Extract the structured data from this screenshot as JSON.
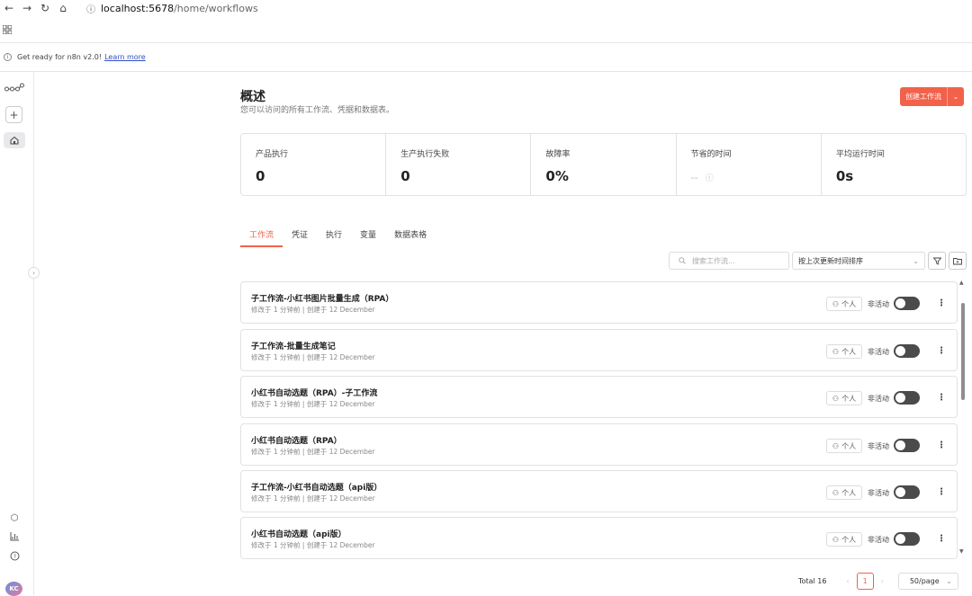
{
  "browser": {
    "url_host": "localhost:5678",
    "url_path": "/home/workflows"
  },
  "banner": {
    "text": "Get ready for n8n v2.0!",
    "link": "Learn more"
  },
  "sidebar": {
    "avatar_initials": "KC"
  },
  "header": {
    "title": "概述",
    "subtitle": "您可以访问的所有工作流、凭据和数据表。",
    "create_label": "创建工作流"
  },
  "stats": [
    {
      "label": "产品执行",
      "value": "0"
    },
    {
      "label": "生产执行失败",
      "value": "0"
    },
    {
      "label": "故障率",
      "value": "0%"
    },
    {
      "label": "节省的时间",
      "value": "--"
    },
    {
      "label": "平均运行时间",
      "value": "0s"
    }
  ],
  "tabs": [
    "工作流",
    "凭证",
    "执行",
    "变量",
    "数据表格"
  ],
  "toolbar": {
    "search_placeholder": "搜索工作流...",
    "sort_label": "按上次更新时间排序"
  },
  "workflows": [
    {
      "name": "子工作流-小红书图片批量生成（RPA）",
      "modified": "修改于 1 分钟前",
      "created": "创建于 12 December",
      "owner": "个人",
      "status": "非活动"
    },
    {
      "name": "子工作流-批量生成笔记",
      "modified": "修改于 1 分钟前",
      "created": "创建于 12 December",
      "owner": "个人",
      "status": "非活动"
    },
    {
      "name": "小红书自动选题（RPA）-子工作流",
      "modified": "修改于 1 分钟前",
      "created": "创建于 12 December",
      "owner": "个人",
      "status": "非活动"
    },
    {
      "name": "小红书自动选题（RPA）",
      "modified": "修改于 1 分钟前",
      "created": "创建于 12 December",
      "owner": "个人",
      "status": "非活动"
    },
    {
      "name": "子工作流-小红书自动选题（api版）",
      "modified": "修改于 1 分钟前",
      "created": "创建于 12 December",
      "owner": "个人",
      "status": "非活动"
    },
    {
      "name": "小红书自动选题（api版）",
      "modified": "修改于 1 分钟前",
      "created": "创建于 12 December",
      "owner": "个人",
      "status": "非活动"
    }
  ],
  "pagination": {
    "total": "Total 16",
    "page": "1",
    "page_size": "50/page"
  },
  "colors": {
    "accent": "#f2614a",
    "toggle_off": "#4b4b4b"
  }
}
